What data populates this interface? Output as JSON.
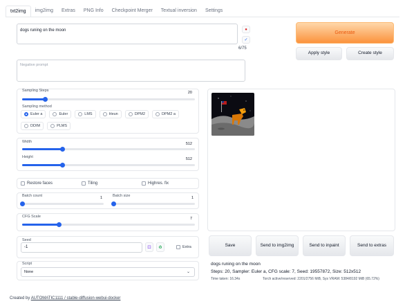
{
  "tabs": [
    "txt2img",
    "img2img",
    "Extras",
    "PNG Info",
    "Checkpoint Merger",
    "Textual inversion",
    "Settings"
  ],
  "prompt": {
    "value": "dogs runing on the moon",
    "counter": "6/75"
  },
  "negative_prompt": {
    "placeholder": "Negative prompt"
  },
  "buttons": {
    "generate": "Generate",
    "apply_style": "Apply style",
    "create_style": "Create style"
  },
  "sampling_steps": {
    "label": "Sampling Steps",
    "value": "20",
    "fraction": 0.13
  },
  "sampling_method": {
    "label": "Sampling method",
    "options": [
      "Euler a",
      "Euler",
      "LMS",
      "Heun",
      "DPM2",
      "DPM2 a",
      "DDIM",
      "PLMS"
    ],
    "selected": "Euler a"
  },
  "width": {
    "label": "Width",
    "value": "512",
    "fraction": 0.23
  },
  "height": {
    "label": "Height",
    "value": "512",
    "fraction": 0.23
  },
  "checkboxes": {
    "restore_faces": "Restore faces",
    "tiling": "Tiling",
    "highres_fix": "Highres. fix"
  },
  "batch_count": {
    "label": "Batch count",
    "value": "1",
    "fraction": 0.0
  },
  "batch_size": {
    "label": "Batch size",
    "value": "1",
    "fraction": 0.0
  },
  "cfg_scale": {
    "label": "CFG Scale",
    "value": "7",
    "fraction": 0.21
  },
  "seed": {
    "label": "Seed",
    "value": "-1",
    "extra_label": "Extra"
  },
  "script": {
    "label": "Script",
    "value": "None"
  },
  "result_actions": {
    "save": "Save",
    "send_img2img": "Send to img2img",
    "send_inpaint": "Send to inpaint",
    "send_extras": "Send to extras"
  },
  "result_info": {
    "prompt": "dogs runing on the moon",
    "params": "Steps: 20, Sampler: Euler a, CFG scale: 7, Seed: 19557872, Size: 512x512",
    "time": "Time taken: 16.34s",
    "vram": "Torch active/reserved: 2201/2756 MiB, Sys VRAM: 5384/8192 MiB (65.72%)"
  },
  "footer": {
    "prefix": "Created by ",
    "link": "AUTOMATIC1111 / stable-diffusion-webui-docker"
  },
  "colors": {
    "accent": "#2563eb",
    "generate_bg": "#fb923c",
    "generate_text": "#ea580c"
  },
  "icons": {
    "paste": "paste-params-icon",
    "trash": "trash-icon",
    "dice": "dice-icon",
    "recycle": "recycle-icon",
    "chevron": "chevron-down-icon"
  }
}
